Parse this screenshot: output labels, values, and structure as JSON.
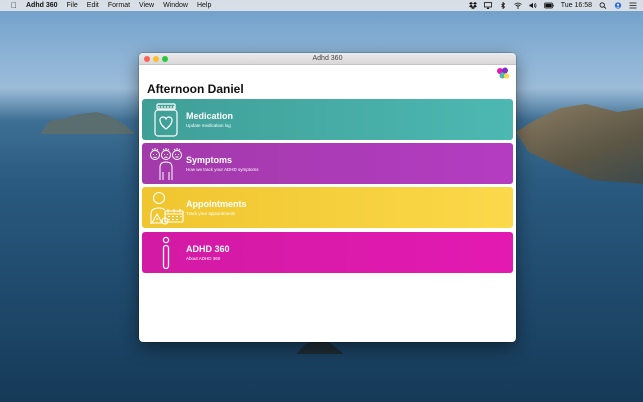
{
  "menubar": {
    "app_name": "Adhd 360",
    "items": [
      "File",
      "Edit",
      "Format",
      "View",
      "Window",
      "Help"
    ],
    "clock": "Tue 16:58"
  },
  "window": {
    "title": "Adhd 360",
    "greeting": "Afternoon Daniel"
  },
  "cards": [
    {
      "title": "Medication",
      "subtitle": "Update medication log",
      "icon": "medication-jar-icon",
      "color": "#4db8b2"
    },
    {
      "title": "Symptoms",
      "subtitle": "How we track your ADHD symptoms",
      "icon": "symptoms-faces-icon",
      "color": "#b43cc2"
    },
    {
      "title": "Appointments",
      "subtitle": "Track your appointments",
      "icon": "appointment-calendar-icon",
      "color": "#fbd94a"
    },
    {
      "title": "ADHD 360",
      "subtitle": "About ADHD 360",
      "icon": "info-icon",
      "color": "#e31ab2"
    }
  ]
}
